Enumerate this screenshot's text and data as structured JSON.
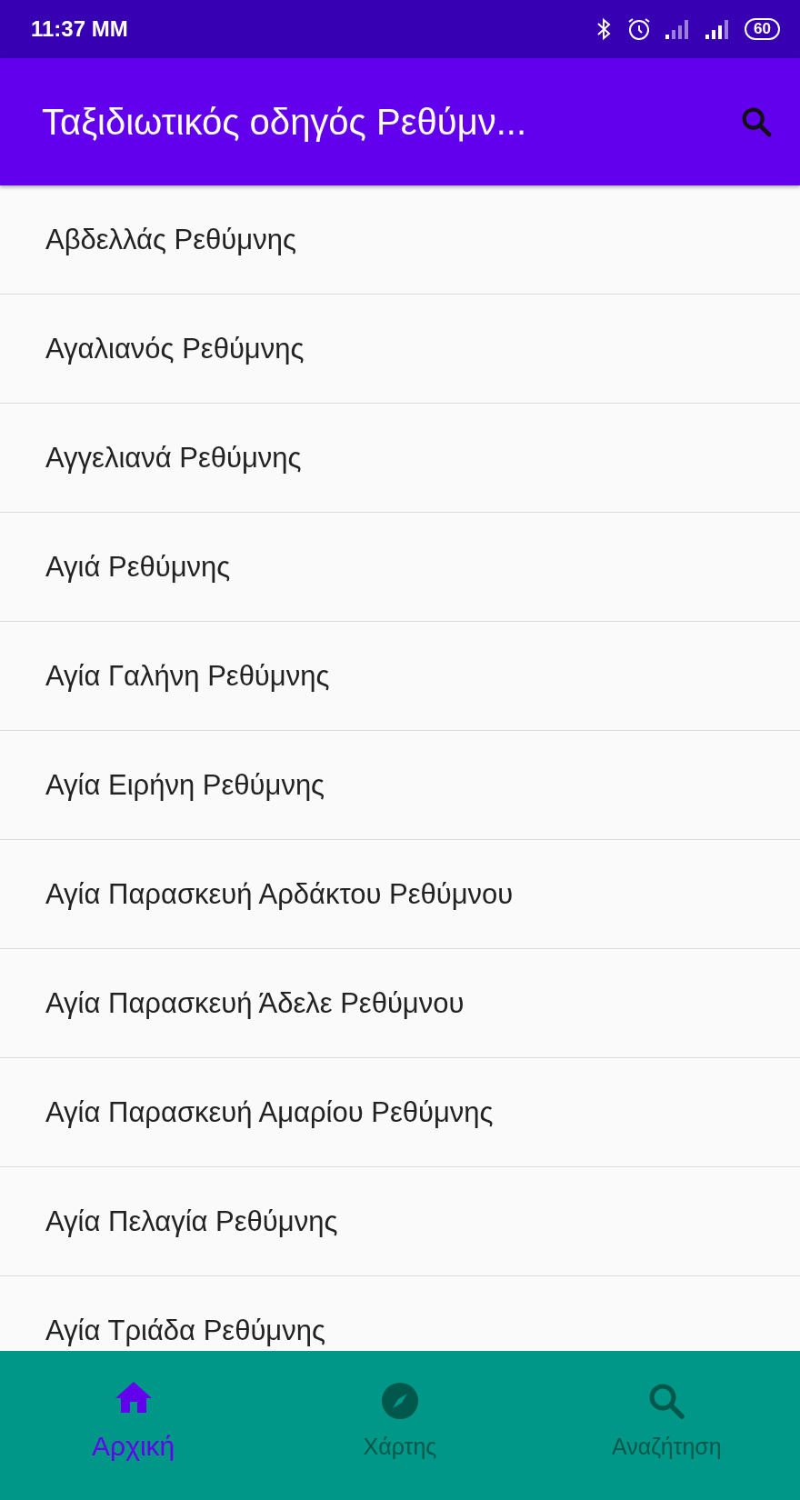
{
  "status_bar": {
    "time": "11:37 MM",
    "battery": "60"
  },
  "app_bar": {
    "title": "Ταξιδιωτικός οδηγός Ρεθύμν..."
  },
  "list": [
    "Αβδελλάς Ρεθύμνης",
    "Αγαλιανός Ρεθύμνης",
    "Αγγελιανά Ρεθύμνης",
    "Αγιά Ρεθύμνης",
    "Αγία Γαλήνη Ρεθύμνης",
    "Αγία Ειρήνη Ρεθύμνης",
    "Αγία Παρασκευή Αρδάκτου Ρεθύμνου",
    "Αγία Παρασκευή Άδελε Ρεθύμνου",
    "Αγία Παρασκευή Αμαρίου Ρεθύμνης",
    "Αγία Πελαγία Ρεθύμνης",
    "Αγία Τριάδα Ρεθύμνης"
  ],
  "bottom_nav": [
    {
      "kind": "home",
      "label": "Αρχική",
      "selected": true
    },
    {
      "kind": "compass",
      "label": "Χάρτης",
      "selected": false
    },
    {
      "kind": "search",
      "label": "Αναζήτηση",
      "selected": false
    }
  ]
}
